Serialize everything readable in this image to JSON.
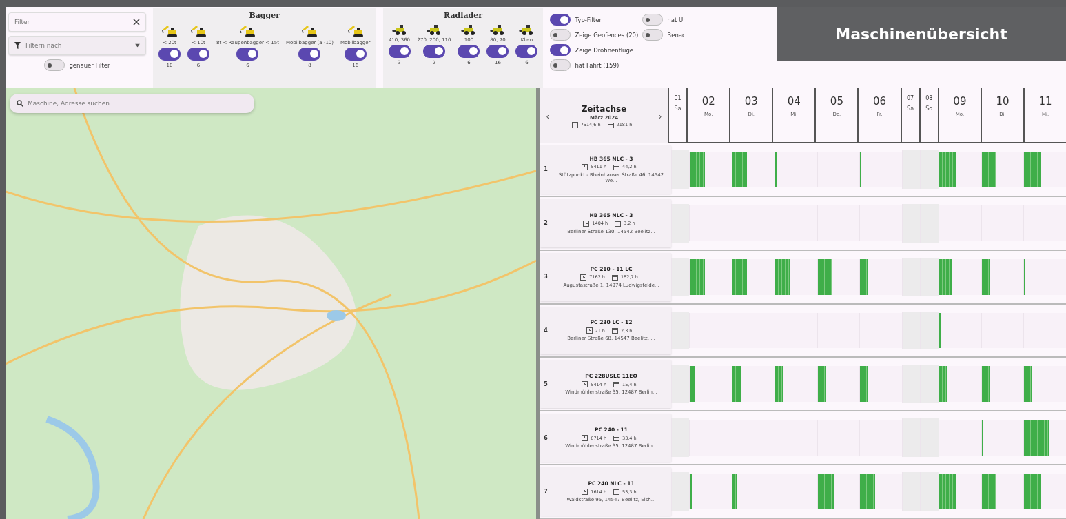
{
  "title": "Maschinenübersicht",
  "filter": {
    "placeholder": "Filter",
    "filter_by": {
      "placeholder": "Filtern nach"
    },
    "exact_filter": {
      "label": "genauer Filter",
      "on": false
    }
  },
  "groups": [
    {
      "title": "Bagger",
      "kind": "excavator",
      "types": [
        {
          "label": "< 20t",
          "on": true,
          "count": "10"
        },
        {
          "label": "< 10t",
          "on": true,
          "count": "6"
        },
        {
          "label": "8t < Raupenbagger < 15t",
          "on": true,
          "count": "6"
        },
        {
          "label": "Mobilbagger (a -10)",
          "on": true,
          "count": "8"
        },
        {
          "label": "Mobilbagger",
          "on": true,
          "count": "16"
        }
      ]
    },
    {
      "title": "Radlader",
      "kind": "loader",
      "types": [
        {
          "label": "410, 360",
          "on": true,
          "count": "3"
        },
        {
          "label": "270, 200, 110",
          "on": true,
          "count": "2"
        },
        {
          "label": "100",
          "on": true,
          "count": "6"
        },
        {
          "label": "80, 70",
          "on": true,
          "count": "16"
        },
        {
          "label": "Klein",
          "on": true,
          "count": "6"
        }
      ]
    }
  ],
  "options": [
    {
      "label": "Typ-Filter",
      "on": true
    },
    {
      "label": "Zeige Geofences (20)",
      "on": false
    },
    {
      "label": "Zeige Drohnenflüge",
      "on": true
    },
    {
      "label": "hat Fahrt (159)",
      "on": false
    },
    {
      "label": "hat Ur",
      "on": false
    },
    {
      "label": "Benac",
      "on": false
    }
  ],
  "map": {
    "search": {
      "placeholder": "Maschine, Adresse suchen..."
    }
  },
  "timeline": {
    "title": "Zeitachse",
    "month": "März 2024",
    "prev": "‹",
    "next": "›",
    "total_hours": "7514,6 h",
    "total_usage": "2181 h",
    "days": [
      {
        "day": "01",
        "weekday": "Sa",
        "weekend": true
      },
      {
        "day": "02",
        "weekday": "Mo.",
        "weekend": false
      },
      {
        "day": "03",
        "weekday": "Di.",
        "weekend": false
      },
      {
        "day": "04",
        "weekday": "Mi.",
        "weekend": false
      },
      {
        "day": "05",
        "weekday": "Do.",
        "weekend": false
      },
      {
        "day": "06",
        "weekday": "Fr.",
        "weekend": false
      },
      {
        "day": "07",
        "weekday": "Sa",
        "weekend": true
      },
      {
        "day": "08",
        "weekday": "So",
        "weekend": true
      },
      {
        "day": "09",
        "weekday": "Mo.",
        "weekend": false
      },
      {
        "day": "10",
        "weekday": "Di.",
        "weekend": false
      },
      {
        "day": "11",
        "weekday": "Mi.",
        "weekend": false
      }
    ],
    "machines": [
      {
        "index": "1",
        "name": "HB 365 NLC - 3",
        "hours": "5411 h",
        "usage": "44,2 h",
        "address": "Stützpunkt - Rheinhauser Straße 46, 14542 We...",
        "days": [
          {
            "active": false
          },
          {
            "active": true,
            "level": 0.35
          },
          {
            "active": true,
            "level": 0.35
          },
          {
            "active": true,
            "level": 0.05
          },
          {
            "active": false
          },
          {
            "active": true,
            "level": 0.03
          },
          {
            "active": false
          },
          {
            "active": false
          },
          {
            "active": true,
            "level": 0.4
          },
          {
            "active": true,
            "level": 0.35
          },
          {
            "active": true,
            "level": 0.4
          }
        ]
      },
      {
        "index": "2",
        "name": "HB 365 NLC - 3",
        "hours": "1404 h",
        "usage": "3,2 h",
        "address": "Berliner Straße 130, 14542 Beelitz...",
        "days": [
          {
            "active": false
          },
          {
            "active": false
          },
          {
            "active": false
          },
          {
            "active": false
          },
          {
            "active": false
          },
          {
            "active": false
          },
          {
            "active": false
          },
          {
            "active": false
          },
          {
            "active": false
          },
          {
            "active": false
          },
          {
            "active": false
          }
        ]
      },
      {
        "index": "3",
        "name": "PC 210 - 11 LC",
        "hours": "7162 h",
        "usage": "182,7 h",
        "address": "Augustastraße 1, 14974 Ludwigsfelde...",
        "days": [
          {
            "active": false
          },
          {
            "active": true,
            "level": 0.35
          },
          {
            "active": true,
            "level": 0.35
          },
          {
            "active": true,
            "level": 0.35
          },
          {
            "active": true,
            "level": 0.35
          },
          {
            "active": true,
            "level": 0.2
          },
          {
            "active": false
          },
          {
            "active": false
          },
          {
            "active": true,
            "level": 0.3
          },
          {
            "active": true,
            "level": 0.2
          },
          {
            "active": true,
            "level": 0.03
          }
        ]
      },
      {
        "index": "4",
        "name": "PC 230 LC - 12",
        "hours": "21 h",
        "usage": "2,3 h",
        "address": "Berliner Straße 68, 14547 Beelitz, ...",
        "days": [
          {
            "active": false
          },
          {
            "active": false
          },
          {
            "active": false
          },
          {
            "active": false
          },
          {
            "active": false
          },
          {
            "active": false
          },
          {
            "active": false
          },
          {
            "active": false
          },
          {
            "active": true,
            "level": 0.04
          },
          {
            "active": false
          },
          {
            "active": false
          }
        ]
      },
      {
        "index": "5",
        "name": "PC 228USLC 11EO",
        "hours": "5414 h",
        "usage": "15,4 h",
        "address": "Windmühlenstraße 35, 12487 Berlin...",
        "days": [
          {
            "active": false
          },
          {
            "active": true,
            "level": 0.12
          },
          {
            "active": true,
            "level": 0.2
          },
          {
            "active": true,
            "level": 0.2
          },
          {
            "active": true,
            "level": 0.2
          },
          {
            "active": true,
            "level": 0.2
          },
          {
            "active": false
          },
          {
            "active": false
          },
          {
            "active": true,
            "level": 0.2
          },
          {
            "active": true,
            "level": 0.2
          },
          {
            "active": true,
            "level": 0.2
          }
        ]
      },
      {
        "index": "6",
        "name": "PC 240 - 11",
        "hours": "6714 h",
        "usage": "33,4 h",
        "address": "Windmühlenstraße 35, 12487 Berlin...",
        "days": [
          {
            "active": false
          },
          {
            "active": false
          },
          {
            "active": false
          },
          {
            "active": false
          },
          {
            "active": false
          },
          {
            "active": false
          },
          {
            "active": false
          },
          {
            "active": false
          },
          {
            "active": false
          },
          {
            "active": true,
            "level": 0.03
          },
          {
            "active": true,
            "level": 0.6
          }
        ]
      },
      {
        "index": "7",
        "name": "PC 240 NLC - 11",
        "hours": "1614 h",
        "usage": "53,3 h",
        "address": "Waldstraße 95, 14547 Beelitz, Elsh...",
        "days": [
          {
            "active": false
          },
          {
            "active": true,
            "level": 0.05
          },
          {
            "active": true,
            "level": 0.1
          },
          {
            "active": false
          },
          {
            "active": true,
            "level": 0.4
          },
          {
            "active": true,
            "level": 0.35
          },
          {
            "active": false
          },
          {
            "active": false
          },
          {
            "active": true,
            "level": 0.4
          },
          {
            "active": true,
            "level": 0.35
          },
          {
            "active": true,
            "level": 0.4
          }
        ]
      }
    ]
  }
}
